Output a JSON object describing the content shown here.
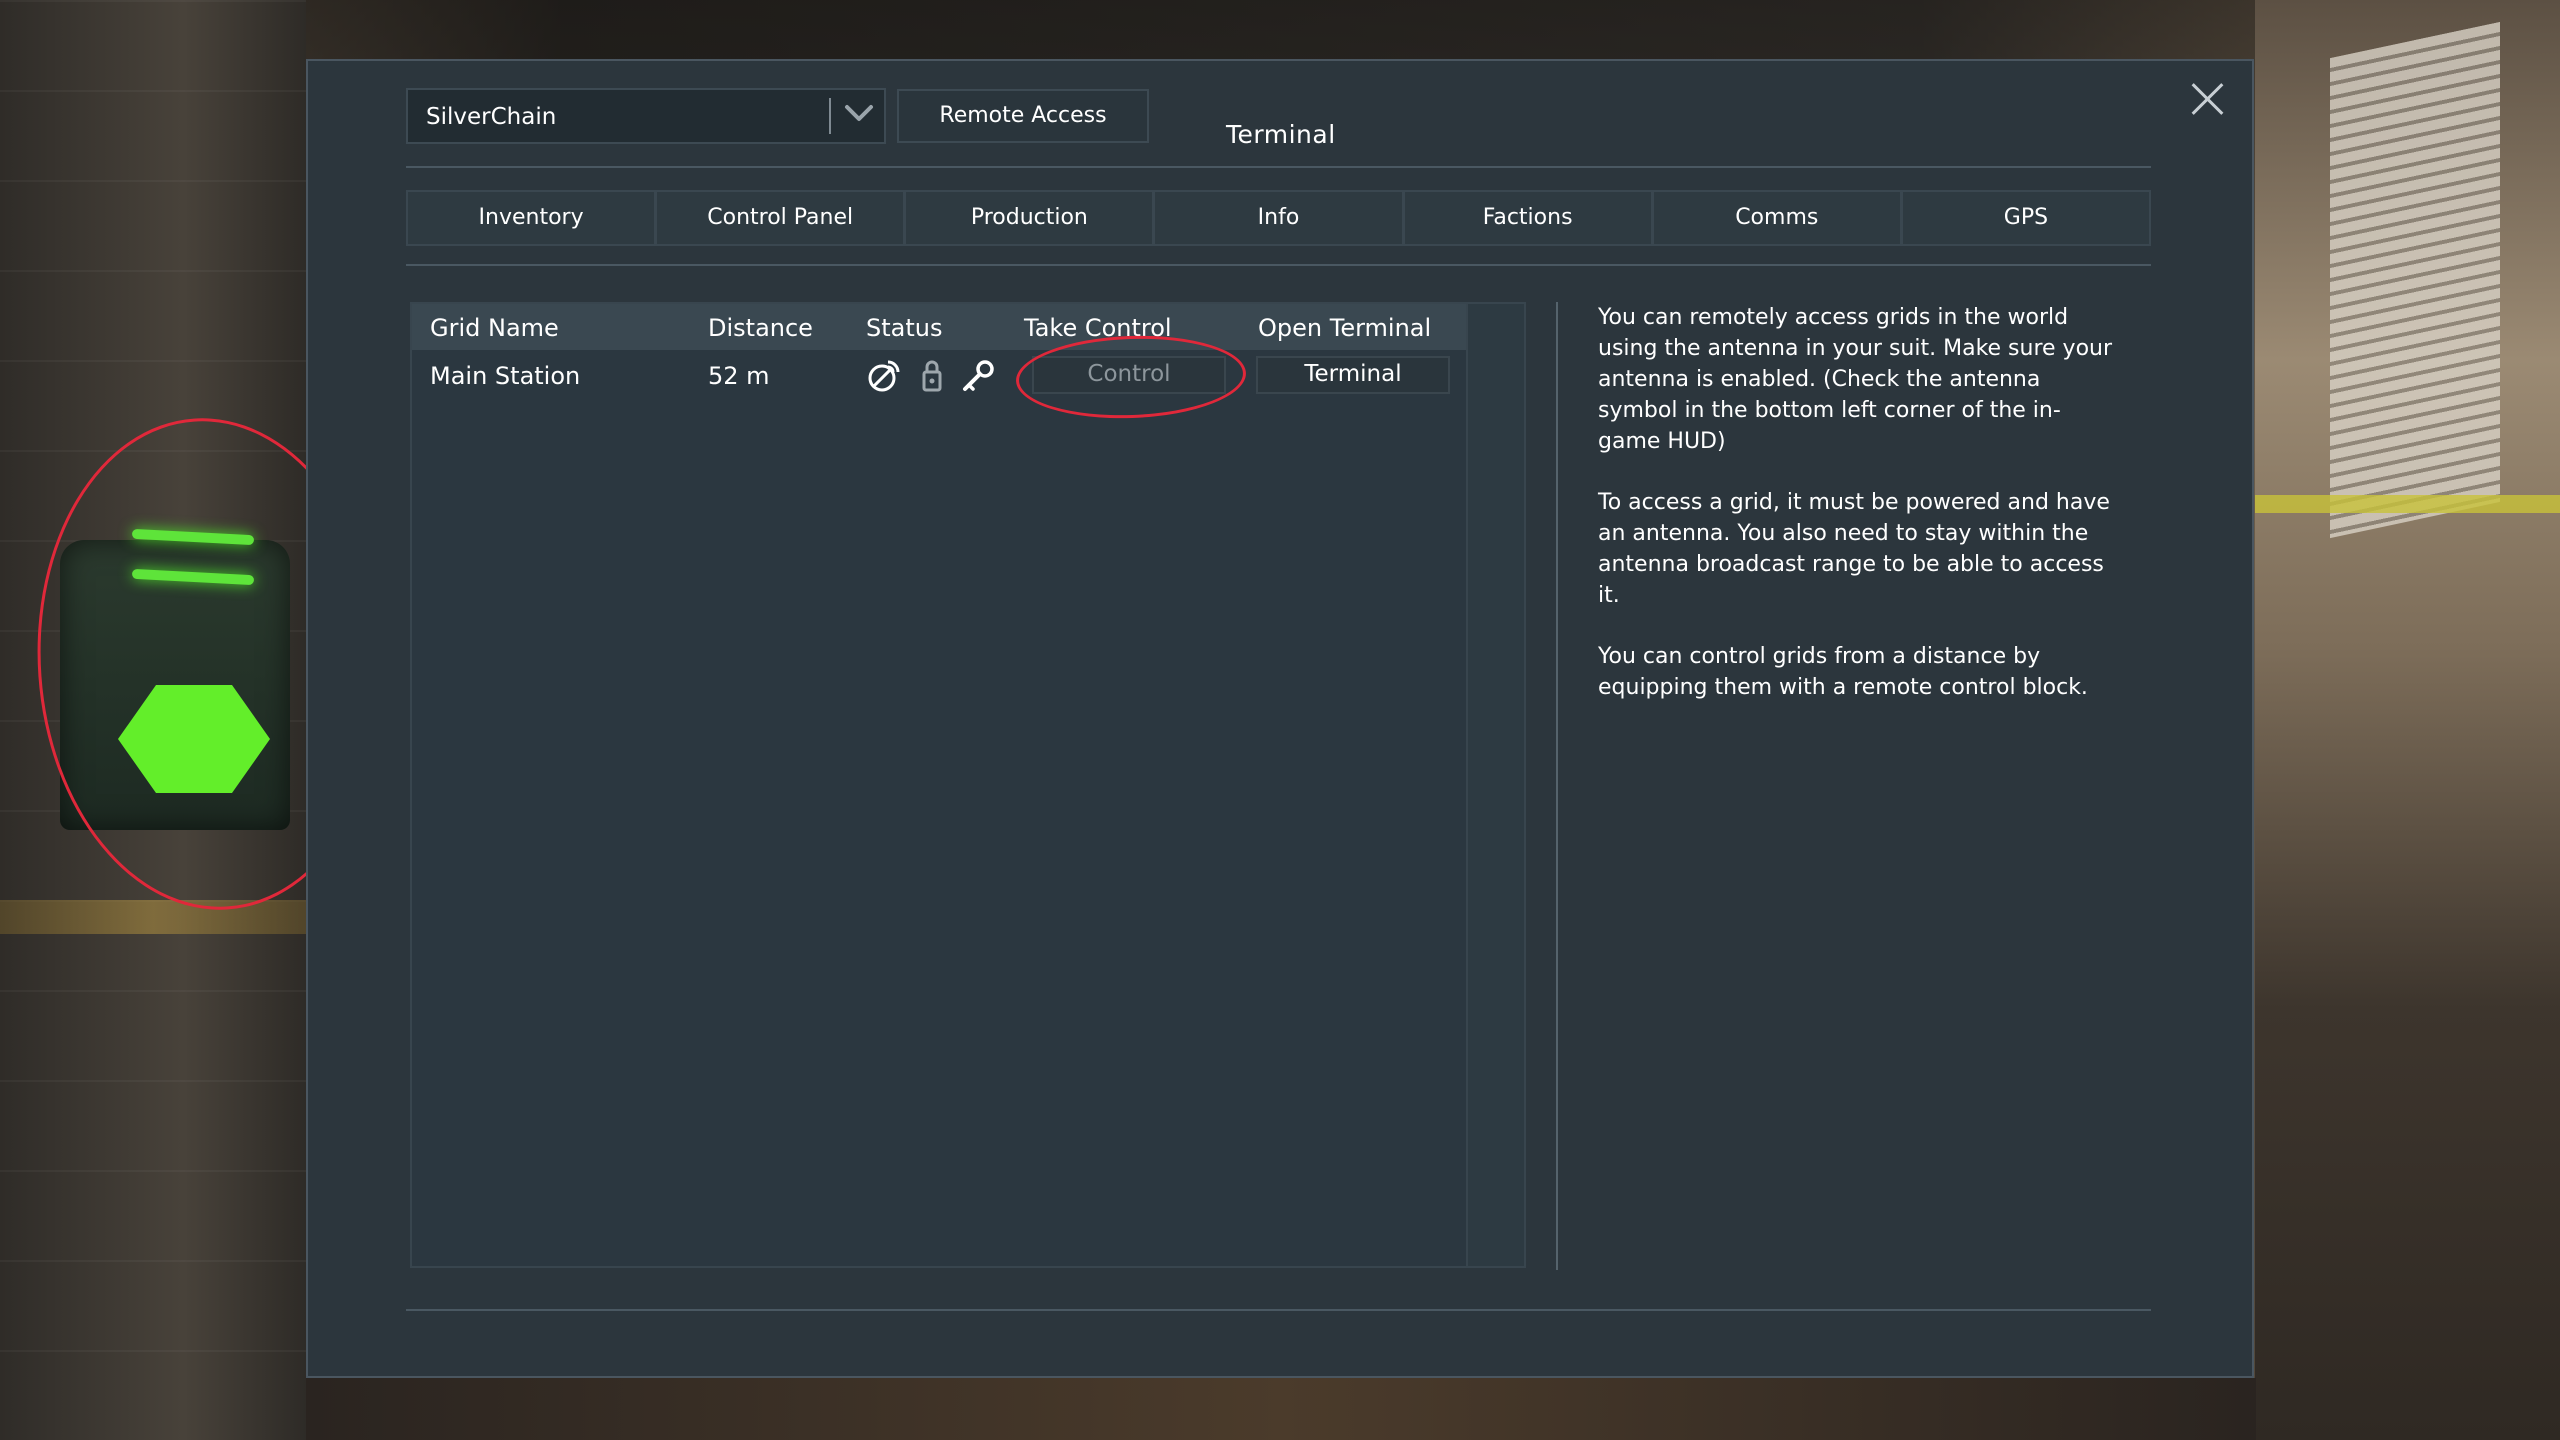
{
  "window": {
    "title": "Terminal",
    "close_label": "close"
  },
  "toolbar": {
    "grid_select_value": "SilverChain",
    "remote_access_label": "Remote Access"
  },
  "tabs": [
    {
      "label": "Inventory"
    },
    {
      "label": "Control Panel"
    },
    {
      "label": "Production"
    },
    {
      "label": "Info"
    },
    {
      "label": "Factions"
    },
    {
      "label": "Comms"
    },
    {
      "label": "GPS"
    }
  ],
  "grid_list": {
    "columns": {
      "grid_name": "Grid Name",
      "distance": "Distance",
      "status": "Status",
      "take_control": "Take Control",
      "open_terminal": "Open Terminal"
    },
    "rows": [
      {
        "grid_name": "Main Station",
        "distance": "52 m",
        "status_icons": [
          "broadcast-icon",
          "remote-lock-icon",
          "key-icon"
        ],
        "control_label": "Control",
        "terminal_label": "Terminal"
      }
    ]
  },
  "help": {
    "paragraphs": [
      "You can remotely access grids in the world using the antenna in your suit. Make sure your antenna is enabled. (Check the antenna symbol in the bottom left corner of the in-game HUD)",
      "To access a grid, it must be powered and have an antenna. You also need to stay within the antenna broadcast range to be able to access it.",
      "You can control grids from a distance by equipping them with a remote control block."
    ]
  },
  "colors": {
    "window_bg": "#2c363d",
    "annotation": "#e0283a",
    "antenna_glow": "#63ee2a"
  }
}
